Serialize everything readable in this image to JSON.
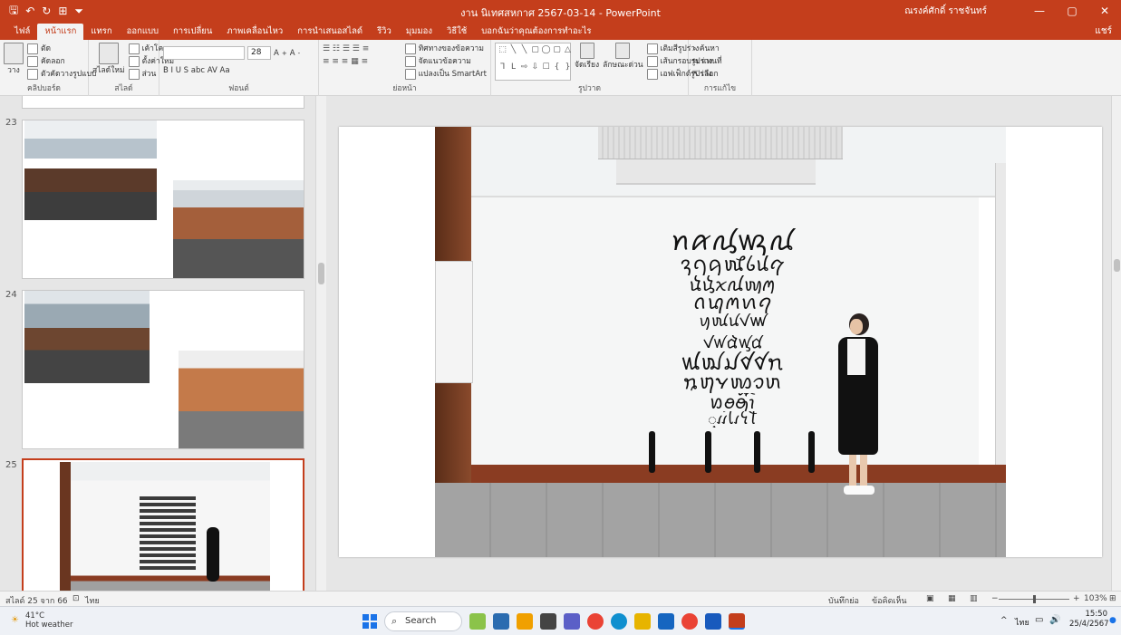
{
  "window": {
    "title": "งาน นิเทศสหกาศ 2567-03-14  -  PowerPoint",
    "user": "ณรงค์ศักดิ์ ราชจันทร์",
    "qat": [
      "🖫",
      "↶",
      "↻",
      "⊞",
      "⏷"
    ],
    "controls": [
      "—",
      "▢",
      "✕"
    ]
  },
  "tabs": [
    {
      "label": "ไฟล์"
    },
    {
      "label": "หน้าแรก"
    },
    {
      "label": "แทรก"
    },
    {
      "label": "ออกแบบ"
    },
    {
      "label": "การเปลี่ยน"
    },
    {
      "label": "ภาพเคลื่อนไหว"
    },
    {
      "label": "การนำเสนอสไลด์"
    },
    {
      "label": "รีวิว"
    },
    {
      "label": "มุมมอง"
    },
    {
      "label": "วิธีใช้"
    },
    {
      "label": "บอกฉันว่าคุณต้องการทำอะไร"
    }
  ],
  "share_label": "แชร์",
  "ribbon": {
    "clipboard": {
      "label": "คลิปบอร์ด",
      "paste": "วาง",
      "cut": "ตัด",
      "copy": "คัดลอก",
      "format_painter": "ตัวคัดวางรูปแบบ"
    },
    "slides": {
      "label": "สไลด์",
      "new_slide": "สไลด์ใหม่",
      "layout": "เค้าโครง",
      "reset": "ตั้งค่าใหม่",
      "section": "ส่วน"
    },
    "font": {
      "label": "ฟอนต์",
      "font_name": "",
      "font_size": "28",
      "format_buttons": "B  I  U  S  abc  AV  Aa"
    },
    "paragraph": {
      "label": "ย่อหน้า",
      "text_direction": "ทิศทางของข้อความ",
      "align_text": "จัดแนวข้อความ",
      "smartart": "แปลงเป็น SmartArt"
    },
    "drawing": {
      "label": "รูปวาด",
      "arrange": "จัดเรียง",
      "quick_styles": "ลักษณะด่วน",
      "shape_fill": "เติมสีรูปร่าง",
      "shape_outline": "เส้นกรอบรูปร่าง",
      "shape_effects": "เอฟเฟ็กต์รูปร่าง",
      "shapes": [
        "⬚",
        "╲",
        "╲",
        "▢",
        "◯",
        "▢",
        "△",
        "ᒣ",
        "ᒪ",
        "⇨",
        "⇩",
        "☐",
        "{",
        "}",
        "☆",
        "⌒",
        "⤺",
        "("
      ]
    },
    "editing": {
      "label": "การแก้ไข",
      "find": "ค้นหา",
      "replace": "แทนที่",
      "select": "เลือก"
    }
  },
  "thumbnails": [
    {
      "number": "23"
    },
    {
      "number": "24"
    },
    {
      "number": "25"
    }
  ],
  "slide_art": {
    "lines": [
      "ꪀꪁꪂꪃꪄ",
      "ꪅꪆꪇꪈꪉꪊꪋ",
      "ꪌꪍꪎꪏꪐꪑ",
      "ꪒꪓꪔꪕꪖ",
      "ꪗꪘꪙꪚꪛ",
      "ꪜꪝꪞꪟꪠ",
      "ꪡꪢꪣꪤꪥꪦ",
      "ꪧꪨꪩꪪꪫꪬ",
      "ꪭꪮꪯꪰꪱꪲꪳ",
      "ꪴꪵꪶꪷꪸꪹꪺꪻ"
    ]
  },
  "statusbar": {
    "slide_info": "สไลด์ 25 จาก 66",
    "language": "ไทย",
    "notes": "บันทึกย่อ",
    "comments": "ข้อคิดเห็น",
    "zoom": "103%",
    "zoom_value": 103
  },
  "taskbar": {
    "weather_temp": "41°C",
    "weather_desc": "Hot weather",
    "search_placeholder": "Search",
    "lang": "ไทย",
    "time": "15:50",
    "date": "25/4/2567",
    "tray_chevron": "^",
    "sound": "🔊"
  },
  "colors": {
    "accent": "#c43e1c",
    "ribbon_bg": "#f3f3f3",
    "workspace": "#e6e6e6"
  }
}
